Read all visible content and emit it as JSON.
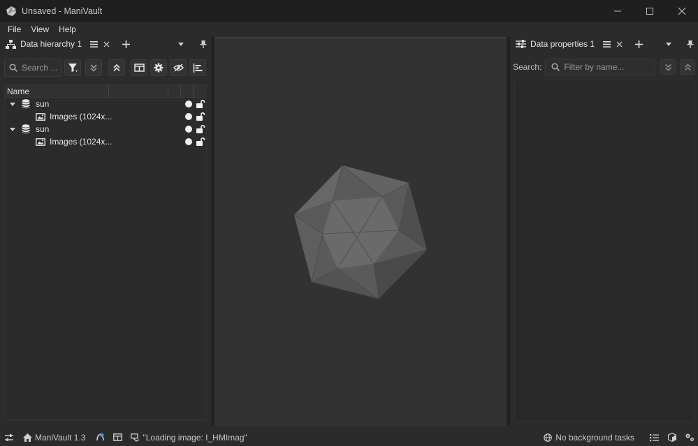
{
  "window": {
    "title": "Unsaved - ManiVault"
  },
  "menu": [
    "File",
    "View",
    "Help"
  ],
  "left_panel": {
    "tab_label": "Data hierarchy 1",
    "search_placeholder": "Search ...",
    "columns": [
      "Name",
      "",
      "",
      "",
      ""
    ],
    "rows": [
      {
        "label": "sun",
        "type": "dataset",
        "expanded": true
      },
      {
        "label": "Images (1024x...",
        "type": "images"
      },
      {
        "label": "sun",
        "type": "dataset",
        "expanded": true
      },
      {
        "label": "Images (1024x...",
        "type": "images"
      }
    ]
  },
  "right_panel": {
    "tab_label": "Data properties 1",
    "search_label": "Search:",
    "filter_placeholder": "Filter by name..."
  },
  "status_bar": {
    "app_version": "ManiVault 1.3",
    "loading_message": "\"Loading image: I_HMImag\"",
    "background_tasks": "No background tasks"
  },
  "colors": {
    "background": "#2b2b2b",
    "titlebar": "#1f1f1f",
    "center_view": "#323232",
    "logo": "#5a5a5a"
  }
}
